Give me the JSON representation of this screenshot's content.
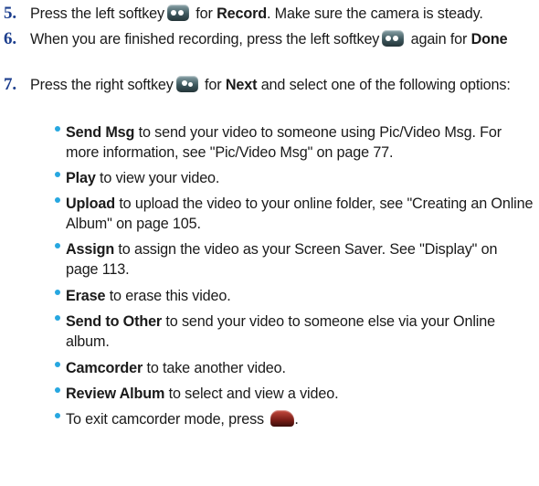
{
  "steps": [
    {
      "number": "5.",
      "text1": "Press the left softkey",
      "icon": "left-softkey-icon",
      "text2": " for ",
      "bold": "Record",
      "text3": ". Make sure the camera is steady."
    },
    {
      "number": "6.",
      "text1": "When you are finished recording, press the left softkey",
      "icon": "left-softkey-icon",
      "text2": " again for ",
      "bold": "Done"
    },
    {
      "number": "7.",
      "text1": "Press the right softkey",
      "icon": "right-softkey-icon",
      "text2": " for ",
      "bold": "Next",
      "text3": " and select one of the following options:"
    }
  ],
  "options": [
    {
      "label": "Send Msg",
      "text": " to send your video to someone using Pic/Video Msg. For more information, see \"Pic/Video Msg\" on page 77."
    },
    {
      "label": "Play",
      "text": " to view your video."
    },
    {
      "label": "Upload",
      "text": " to upload the video to your online folder, see \"Creating an Online Album\" on page 105."
    },
    {
      "label": "Assign",
      "text": " to assign the video as your Screen Saver. See \"Display\" on page 113."
    },
    {
      "label": "Erase",
      "text": " to erase this video."
    },
    {
      "label": "Send to Other",
      "text": " to send your video to someone else via your Online album."
    },
    {
      "label": "Camcorder",
      "text": " to take another video."
    },
    {
      "label": "Review Album",
      "text": " to select and view a video."
    },
    {
      "label": "",
      "text": "To exit camcorder mode, press ",
      "icon": "end-key-icon",
      "suffix": "."
    }
  ],
  "colors": {
    "step_number": "#1d3f8e",
    "bullet": "#27a7e0",
    "text": "#1a1a1a"
  }
}
